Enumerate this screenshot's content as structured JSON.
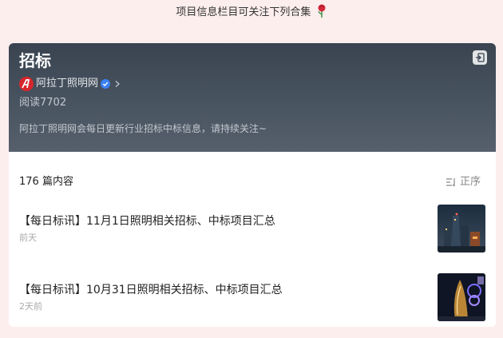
{
  "intro": {
    "text": "项目信息栏目可关注下列合集"
  },
  "collection": {
    "title": "招标",
    "account_name": "阿拉丁照明网",
    "reads": "阅读7702",
    "description": "阿拉丁照明网会每日更新行业招标中标信息，请持续关注~"
  },
  "list": {
    "count_text": "176 篇内容",
    "sort_label": "正序",
    "items": [
      {
        "title": "【每日标讯】11月1日照明相关招标、中标项目汇总",
        "time": "前天"
      },
      {
        "title": "【每日标讯】10月31日照明相关招标、中标项目汇总",
        "time": "2天前"
      }
    ]
  },
  "colors": {
    "page_bg": "#fdeeee",
    "header_bg": "#3a4451",
    "accent_verified": "#3b82f6",
    "logo_red": "#d7262b"
  }
}
